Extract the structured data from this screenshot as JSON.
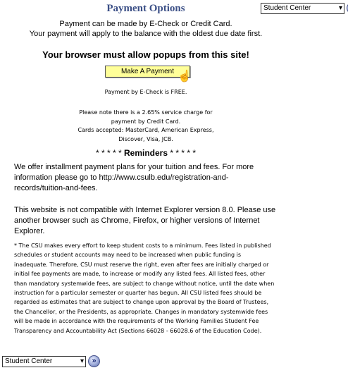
{
  "header": {
    "title": "Payment Options"
  },
  "nav": {
    "select_value": "Student Center",
    "go_icon": "double-chevron-right-icon"
  },
  "intro": {
    "line1": "Payment can be made by E-Check or Credit Card.",
    "line2": "Your payment will apply to the balance with the oldest due date first."
  },
  "popup_warning": "Your browser must allow popups from this site!",
  "make_payment_label": "Make A Payment",
  "echeck_note": "Payment by E-Check is FREE.",
  "charge_note": {
    "line1": "Please note there is a 2.65% service charge for",
    "line2": "payment by Credit Card.",
    "line3": "Cards accepted: MasterCard, American Express,",
    "line4": "Discover, Visa, JCB."
  },
  "reminders": {
    "stars_left": "* * * * *",
    "title": "Reminders",
    "stars_right": "* * * * *"
  },
  "installment_text": "We offer installment payment plans for your tuition and fees. For more information please go to http://www.csulb.edu/registration-and-records/tuition-and-fees.",
  "browser_text": "This website is not compatible with Internet Explorer version 8.0. Please use another browser such as Chrome, Firefox, or higher versions of Internet Explorer.",
  "legal_text": "* The CSU makes every effort to keep student costs to a minimum. Fees listed in published schedules or student accounts may need to be increased when public funding is inadequate. Therefore, CSU must reserve the right, even after fees are initially charged or initial fee payments are made, to increase or modify any listed fees. All listed fees, other than mandatory systemwide fees, are subject to change without notice, until the date when instruction for a particular semester or quarter has begun. All CSU listed fees should be regarded as estimates that are subject to change upon approval by the Board of Trustees, the Chancellor, or the Presidents, as appropriate. Changes in mandatory systemwide fees will be made in accordance with the requirements of the Working Families Student Fee Transparency and Accountability Act (Sections 66028 - 66028.6 of the Education Code)."
}
